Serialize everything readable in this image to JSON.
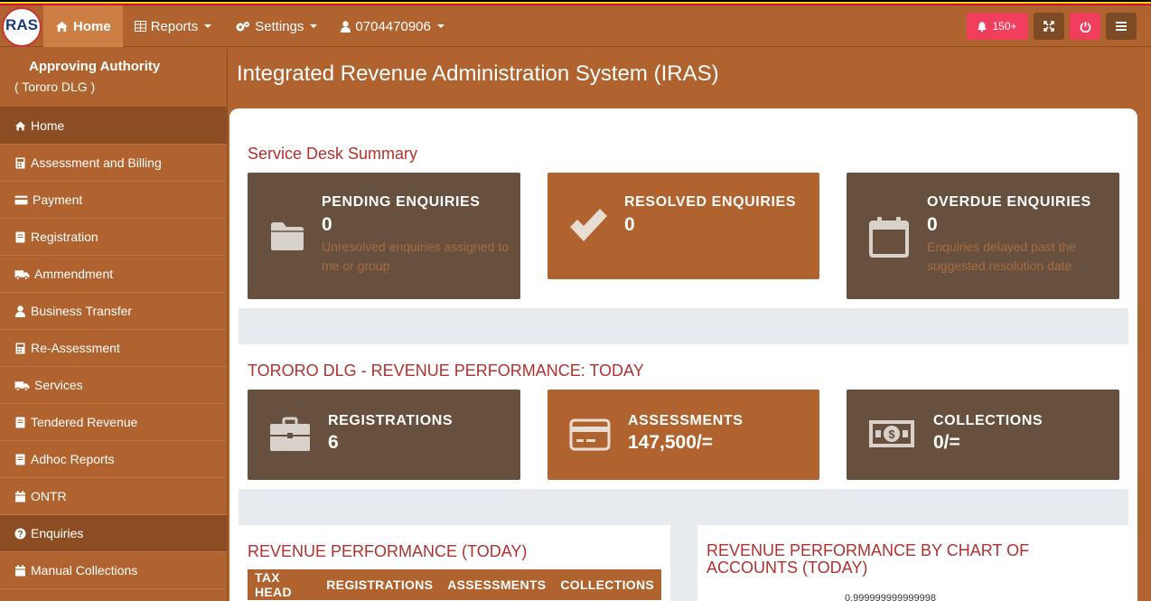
{
  "logo": {
    "text": "RAS"
  },
  "nav": {
    "home": "Home",
    "reports": "Reports",
    "settings": "Settings",
    "user": "0704470906"
  },
  "topright": {
    "notifications": "150+"
  },
  "sidebar": {
    "title": "Approving Authority",
    "subtitle": "( Tororo DLG )",
    "items": [
      {
        "label": "Home",
        "icon": "home-icon"
      },
      {
        "label": "Assessment and Billing",
        "icon": "calculator-icon"
      },
      {
        "label": "Payment",
        "icon": "credit-card-icon"
      },
      {
        "label": "Registration",
        "icon": "book-icon"
      },
      {
        "label": "Ammendment",
        "icon": "truck-icon"
      },
      {
        "label": "Business Transfer",
        "icon": "user-icon"
      },
      {
        "label": "Re-Assessment",
        "icon": "calculator-icon"
      },
      {
        "label": "Services",
        "icon": "truck-icon"
      },
      {
        "label": "Tendered Revenue",
        "icon": "book-icon"
      },
      {
        "label": "Adhoc Reports",
        "icon": "book-icon"
      },
      {
        "label": "ONTR",
        "icon": "calendar-icon"
      },
      {
        "label": "Enquiries",
        "icon": "question-icon"
      },
      {
        "label": "Manual Collections",
        "icon": "calendar-icon"
      }
    ]
  },
  "header": {
    "title": "Integrated Revenue Administration System (IRAS)"
  },
  "service_desk": {
    "title": "Service Desk Summary",
    "cards": [
      {
        "title": "PENDING ENQUIRIES",
        "value": "0",
        "desc": "Unresolved enquiries assigned to me or group",
        "icon": "folder-icon"
      },
      {
        "title": "RESOLVED ENQUIRIES",
        "value": "0",
        "desc": "",
        "icon": "check-icon"
      },
      {
        "title": "OVERDUE ENQUIRIES",
        "value": "0",
        "desc": "Enquiries delayed past the suggested resolution date",
        "icon": "calendar-icon"
      }
    ]
  },
  "revenue": {
    "title": "TORORO DLG - REVENUE PERFORMANCE: TODAY",
    "cards": [
      {
        "title": "REGISTRATIONS",
        "value": "6",
        "icon": "briefcase-icon"
      },
      {
        "title": "ASSESSMENTS",
        "value": "147,500/=",
        "icon": "credit-card-icon"
      },
      {
        "title": "COLLECTIONS",
        "value": "0/=",
        "icon": "money-icon"
      }
    ]
  },
  "performance": {
    "table_title": "REVENUE PERFORMANCE (TODAY)",
    "columns": [
      "TAX HEAD",
      "REGISTRATIONS",
      "ASSESSMENTS",
      "COLLECTIONS"
    ],
    "chart_title": "REVENUE PERFORMANCE BY CHART OF ACCOUNTS (TODAY)",
    "chart_partial_label": "0.999999999999998"
  }
}
